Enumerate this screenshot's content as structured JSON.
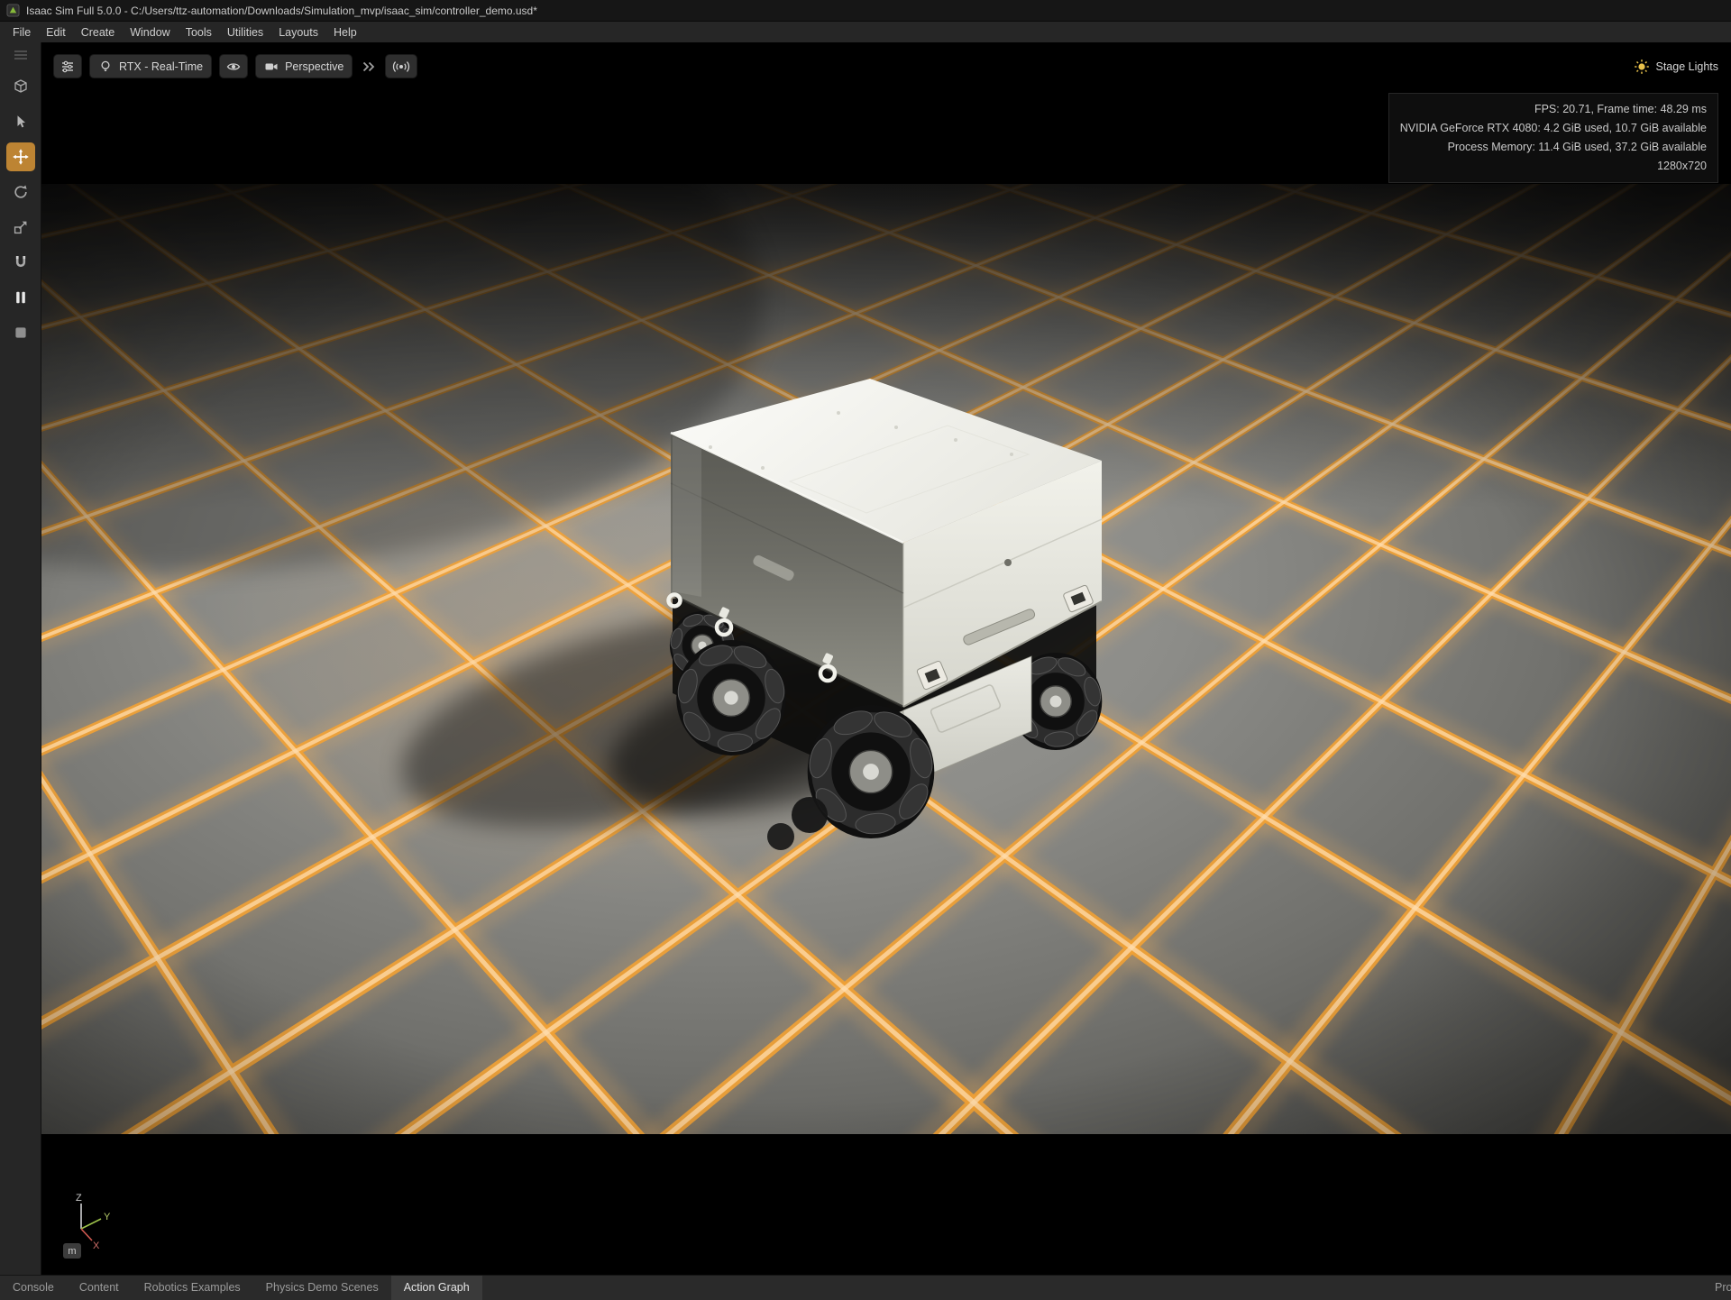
{
  "window": {
    "title": "Isaac Sim Full 5.0.0 - C:/Users/ttz-automation/Downloads/Simulation_mvp/isaac_sim/controller_demo.usd*"
  },
  "menu": {
    "items": [
      "File",
      "Edit",
      "Create",
      "Window",
      "Tools",
      "Utilities",
      "Layouts",
      "Help"
    ]
  },
  "viewport_toolbar": {
    "renderer_label": "RTX - Real-Time",
    "camera_label": "Perspective",
    "stage_lights_label": "Stage Lights"
  },
  "stats": {
    "fps": "FPS: 20.71, Frame time: 48.29 ms",
    "gpu": "NVIDIA GeForce RTX 4080: 4.2 GiB used, 10.7 GiB available",
    "memory": "Process Memory: 11.4 GiB used, 37.2 GiB available",
    "resolution": "1280x720"
  },
  "gizmo": {
    "x": "X",
    "y": "Y",
    "z": "Z",
    "unit": "m"
  },
  "bottom_tabs": {
    "items": [
      {
        "label": "Console",
        "active": false
      },
      {
        "label": "Content",
        "active": false
      },
      {
        "label": "Robotics Examples",
        "active": false
      },
      {
        "label": "Physics Demo Scenes",
        "active": false
      },
      {
        "label": "Action Graph",
        "active": true
      }
    ],
    "right_item": "Pro"
  },
  "left_toolbar": {
    "active_tool": "move-tool",
    "tools": [
      "selection-mode",
      "select-tool",
      "move-tool",
      "rotate-tool",
      "scale-tool",
      "snap-tool",
      "pause",
      "stop"
    ]
  },
  "icons": {
    "app-icon": "isaac-sim-logo",
    "settings-sliders-icon": "sliders",
    "lightbulb-icon": "bulb",
    "eye-icon": "eye",
    "camera-icon": "video-camera",
    "double-chevron-icon": "chevrons-right",
    "waypoint-icon": "signal-dot",
    "sun-icon": "sun",
    "axis-gizmo": "xyz-axes"
  },
  "colors": {
    "grid_line": "#f0a135",
    "grid_glow": "#ffb85c",
    "grid_hot": "#ffdcae",
    "tool_active_bg": "#bd8433",
    "stage_light_icon": "#e8c14b"
  }
}
